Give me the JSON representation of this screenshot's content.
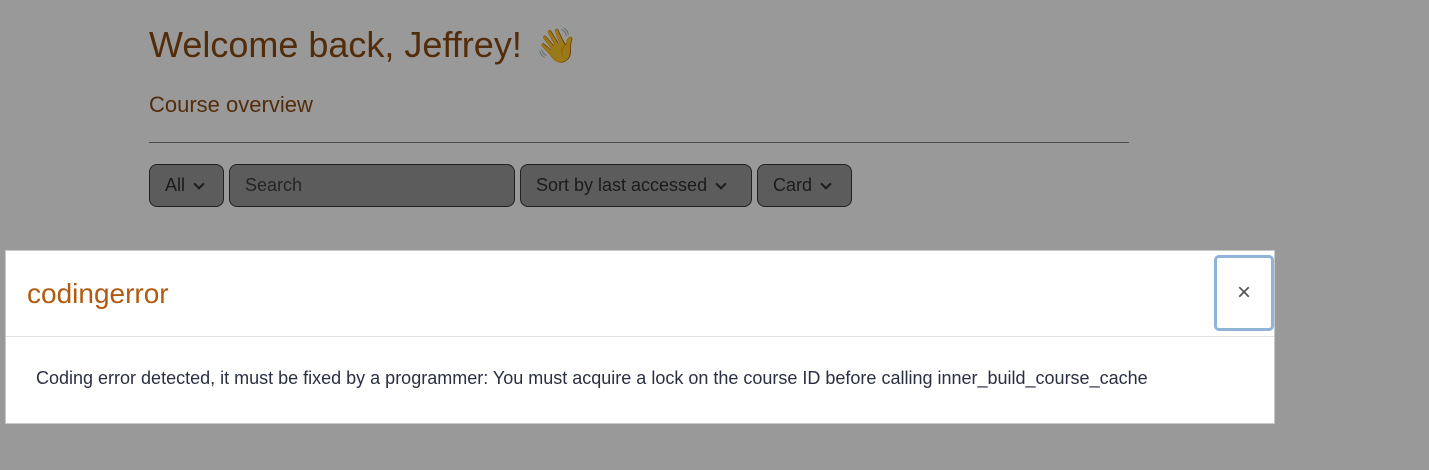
{
  "page": {
    "welcome_text": "Welcome back, Jeffrey!",
    "wave_emoji": "👋",
    "section_title": "Course overview"
  },
  "filters": {
    "grouping_label": "All",
    "search_placeholder": "Search",
    "sort_label": "Sort by last accessed",
    "view_label": "Card"
  },
  "modal": {
    "title": "codingerror",
    "close_symbol": "×",
    "message": "Coding error detected, it must be fixed by a programmer: You must acquire a lock on the course ID before calling inner_build_course_cache"
  },
  "colors": {
    "heading": "#8a4a12",
    "modal_title": "#b35a10",
    "backdrop": "rgba(0,0,0,0.40)",
    "focus_ring": "#8fb3d9"
  },
  "icons": {
    "wave": "waving-hand-icon",
    "dropdown": "chevron-down-icon",
    "close": "close-icon"
  }
}
